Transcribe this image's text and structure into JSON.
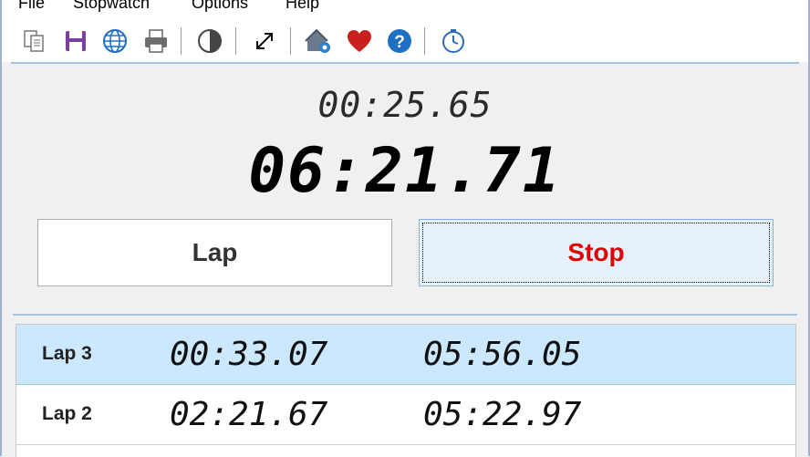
{
  "menu": [
    "File",
    "Stopwatch",
    "Options",
    "Help"
  ],
  "toolbar_icons": [
    "copy-icon",
    "save-icon",
    "globe-icon",
    "print-icon",
    "contrast-icon",
    "fullscreen-icon",
    "home-settings-icon",
    "heart-icon",
    "help-icon",
    "clock-icon"
  ],
  "colors": {
    "stop_text": "#e00000",
    "selected_row": "#cce8ff",
    "accent_line": "#a8c4e0"
  },
  "display": {
    "lap_time": "00:25.65",
    "total_time": "06:21.71"
  },
  "buttons": {
    "lap": "Lap",
    "stop": "Stop"
  },
  "laps": [
    {
      "name": "Lap 3",
      "lap_time": "00:33.07",
      "total": "05:56.05",
      "selected": true
    },
    {
      "name": "Lap 2",
      "lap_time": "02:21.67",
      "total": "05:22.97",
      "selected": false
    }
  ]
}
